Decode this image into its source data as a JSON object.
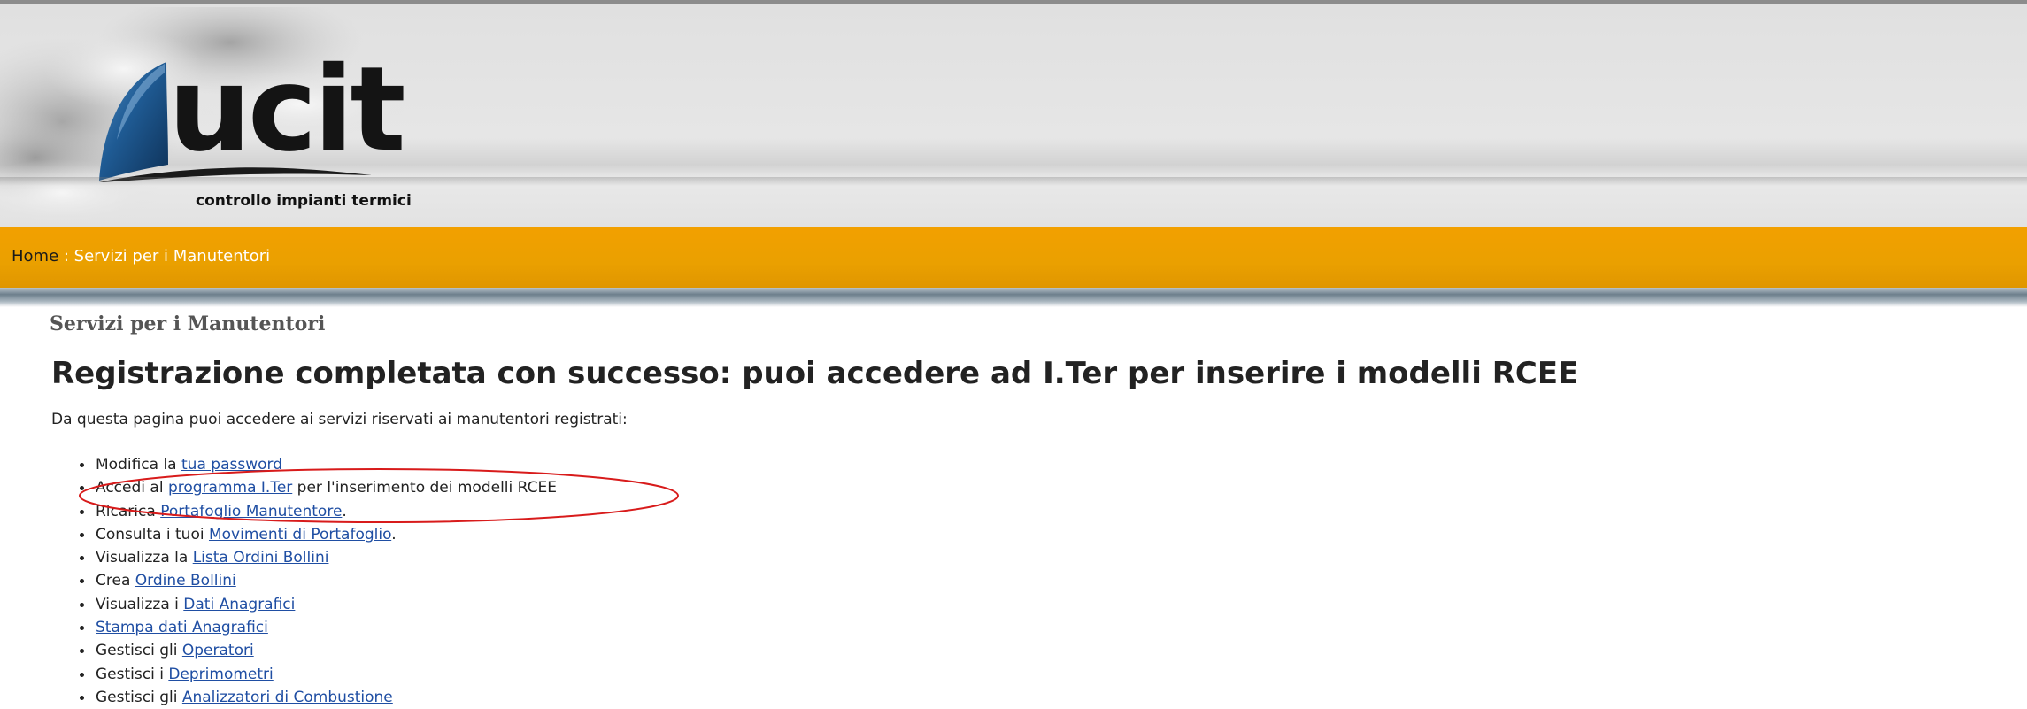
{
  "header": {
    "logo_text": "ucit",
    "logo_tagline": "controllo impianti termici"
  },
  "breadcrumb": {
    "home": "Home",
    "separator": " : ",
    "current": "Servizi per i Manutentori"
  },
  "content": {
    "section_title": "Servizi per i Manutentori",
    "heading": "Registrazione completata con successo: puoi accedere ad I.Ter per inserire i modelli RCEE",
    "intro": "Da questa pagina puoi accedere ai servizi riservati ai manutentori registrati:",
    "items": [
      {
        "prefix": "Modifica la ",
        "link": "tua password",
        "suffix": ""
      },
      {
        "prefix": "Accedi al ",
        "link": "programma I.Ter",
        "suffix": " per l'inserimento dei modelli RCEE"
      },
      {
        "prefix": "Ricarica ",
        "link": "Portafoglio Manutentore",
        "suffix": "."
      },
      {
        "prefix": "Consulta i tuoi ",
        "link": "Movimenti di Portafoglio",
        "suffix": "."
      },
      {
        "prefix": "Visualizza la ",
        "link": "Lista Ordini Bollini",
        "suffix": ""
      },
      {
        "prefix": "Crea ",
        "link": "Ordine Bollini",
        "suffix": ""
      },
      {
        "prefix": "Visualizza i ",
        "link": "Dati Anagrafici",
        "suffix": ""
      },
      {
        "prefix": "",
        "link": "Stampa dati Anagrafici",
        "suffix": ""
      },
      {
        "prefix": "Gestisci gli ",
        "link": "Operatori",
        "suffix": ""
      },
      {
        "prefix": "Gestisci i ",
        "link": "Deprimometri",
        "suffix": ""
      },
      {
        "prefix": "Gestisci gli ",
        "link": "Analizzatori di Combustione",
        "suffix": ""
      }
    ]
  },
  "colors": {
    "breadcrumb_bar": "#eea200",
    "link": "#1f4ea3",
    "annotation": "#d81b1b",
    "logo_sail": "#1a4f80"
  },
  "icons": {
    "logo_mark": "sail-icon"
  }
}
